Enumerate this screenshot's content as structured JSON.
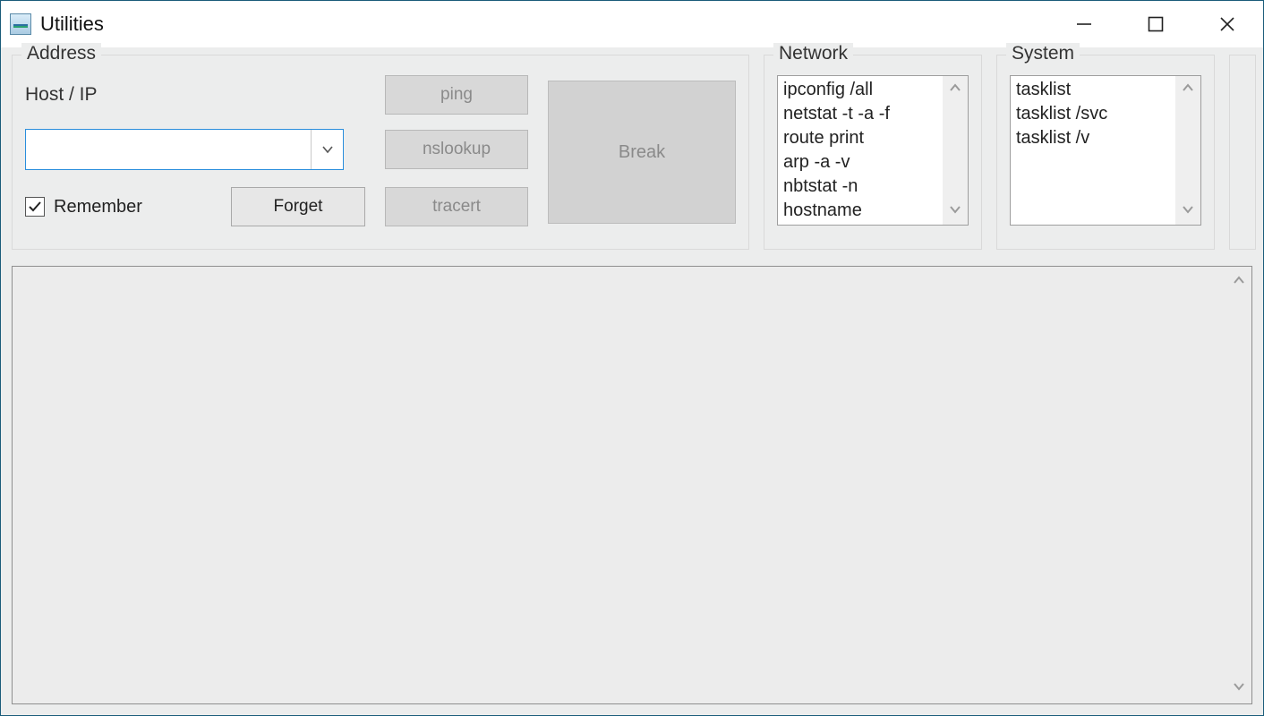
{
  "window": {
    "title": "Utilities"
  },
  "address": {
    "legend": "Address",
    "host_label": "Host / IP",
    "host_value": "",
    "remember_label": "Remember",
    "remember_checked": true,
    "forget_label": "Forget",
    "ping_label": "ping",
    "nslookup_label": "nslookup",
    "tracert_label": "tracert",
    "break_label": "Break"
  },
  "network": {
    "legend": "Network",
    "items": [
      "ipconfig /all",
      "netstat -t -a -f",
      "route print",
      "arp -a -v",
      "nbtstat -n",
      "hostname"
    ]
  },
  "system": {
    "legend": "System",
    "items": [
      "tasklist",
      "tasklist /svc",
      "tasklist /v"
    ]
  },
  "output": {
    "text": ""
  }
}
